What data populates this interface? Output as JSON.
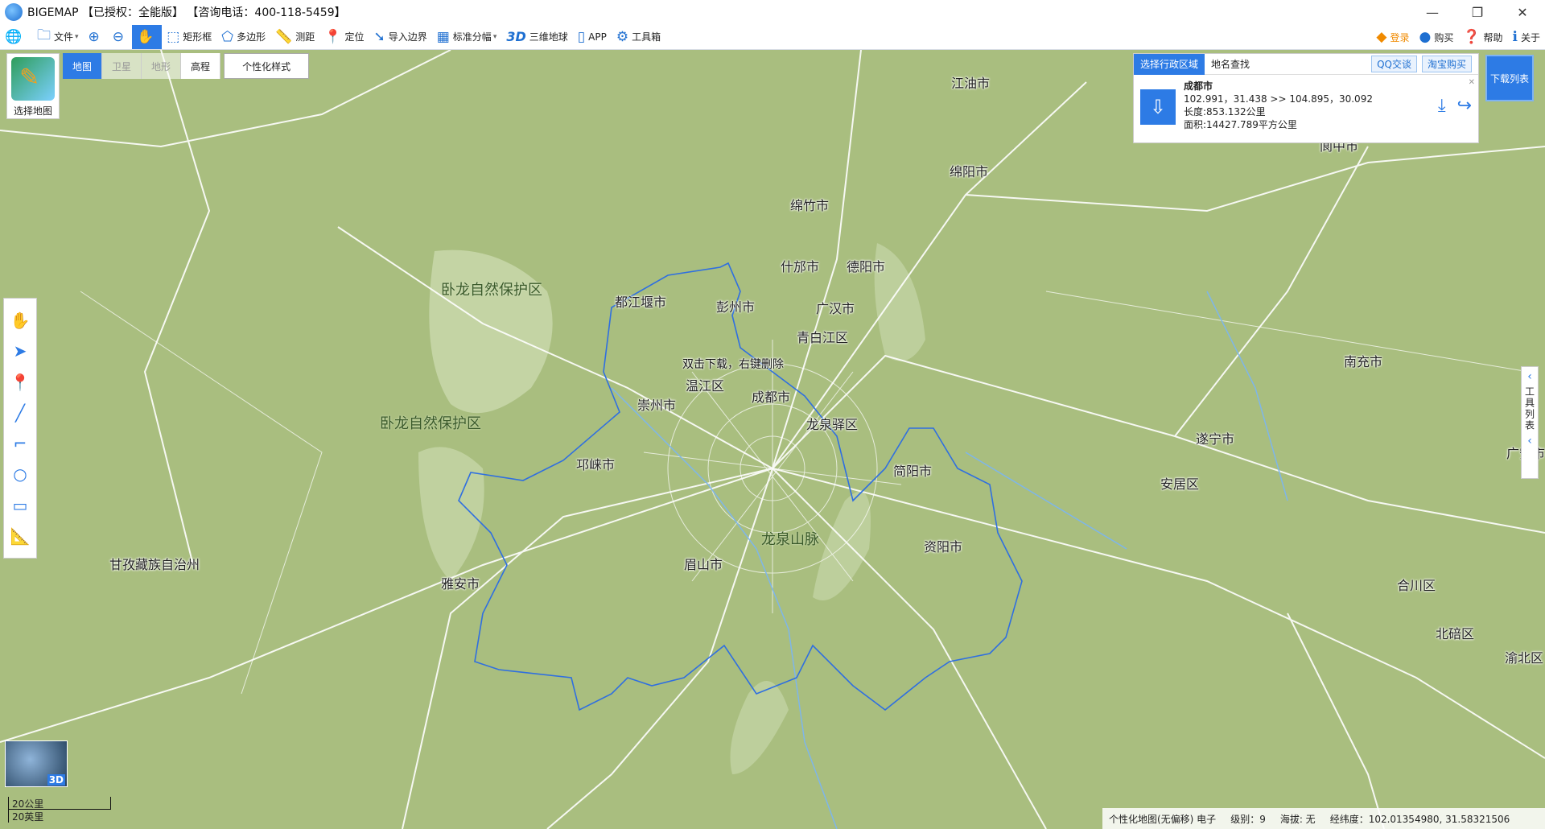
{
  "window": {
    "title": "BIGEMAP 【已授权：全能版】 【咨询电话：400-118-5459】",
    "controls": [
      "—",
      "❐",
      "✕"
    ]
  },
  "toolbar": {
    "items": [
      {
        "label": "文件",
        "icon": "folder-icon",
        "caret": "▾"
      },
      {
        "label": "",
        "icon": "zoom-in-icon"
      },
      {
        "label": "",
        "icon": "zoom-out-icon"
      },
      {
        "label": "",
        "icon": "hand-icon"
      },
      {
        "label": "矩形框",
        "icon": "rectangle-select-icon"
      },
      {
        "label": "多边形",
        "icon": "polygon-icon"
      },
      {
        "label": "测距",
        "icon": "ruler-icon"
      },
      {
        "label": "定位",
        "icon": "location-icon"
      },
      {
        "label": "导入边界",
        "icon": "import-boundary-icon"
      },
      {
        "label": "标准分幅",
        "icon": "grid-icon",
        "caret": "▾"
      },
      {
        "label": "三维地球",
        "icon": "3d-icon",
        "prefix": "3D"
      },
      {
        "label": "APP",
        "icon": "phone-icon"
      },
      {
        "label": "工具箱",
        "icon": "gear-icon"
      }
    ],
    "right": [
      {
        "label": "登录",
        "icon": "user-icon"
      },
      {
        "label": "购买",
        "icon": "buy-icon"
      },
      {
        "label": "帮助",
        "icon": "help-icon"
      },
      {
        "label": "关于",
        "icon": "info-icon"
      }
    ]
  },
  "map_type": {
    "label": "选择地图",
    "tabs": [
      "地图",
      "卫星",
      "地形",
      "高程"
    ],
    "active_tab": "地图",
    "custom_style": "个性化样式"
  },
  "right_panel": {
    "tabs": [
      "选择行政区域",
      "地名查找"
    ],
    "qq": "QQ交谈",
    "taobao": "淘宝购买",
    "region": {
      "name": "成都市",
      "coords": "102.991，31.438 >> 104.895，30.092",
      "length": "长度:853.132公里",
      "area": "面积:14427.789平方公里"
    },
    "download_list": "下载列表",
    "tool_list": "工具列表"
  },
  "map_labels": [
    {
      "text": "江油市",
      "type": "city"
    },
    {
      "text": "绵阳市",
      "type": "city"
    },
    {
      "text": "阆中市",
      "type": "city"
    },
    {
      "text": "绵竹市",
      "type": "city"
    },
    {
      "text": "什邡市",
      "type": "city"
    },
    {
      "text": "德阳市",
      "type": "city"
    },
    {
      "text": "卧龙自然保护区",
      "type": "area"
    },
    {
      "text": "都江堰市",
      "type": "city"
    },
    {
      "text": "彭州市",
      "type": "city"
    },
    {
      "text": "广汉市",
      "type": "city"
    },
    {
      "text": "青白江区",
      "type": "city"
    },
    {
      "text": "双击下载，右键删除",
      "type": "hint"
    },
    {
      "text": "温江区",
      "type": "city"
    },
    {
      "text": "成都市",
      "type": "city"
    },
    {
      "text": "崇州市",
      "type": "city"
    },
    {
      "text": "龙泉驿区",
      "type": "city"
    },
    {
      "text": "南充市",
      "type": "city"
    },
    {
      "text": "卧龙自然保护区",
      "type": "area"
    },
    {
      "text": "遂宁市",
      "type": "city"
    },
    {
      "text": "邛崃市",
      "type": "city"
    },
    {
      "text": "简阳市",
      "type": "city"
    },
    {
      "text": "广安市",
      "type": "city"
    },
    {
      "text": "安居区",
      "type": "city"
    },
    {
      "text": "龙泉山脉",
      "type": "area"
    },
    {
      "text": "资阳市",
      "type": "city"
    },
    {
      "text": "甘孜藏族自治州",
      "type": "city"
    },
    {
      "text": "眉山市",
      "type": "city"
    },
    {
      "text": "雅安市",
      "type": "city"
    },
    {
      "text": "合川区",
      "type": "city"
    },
    {
      "text": "北碚区",
      "type": "city"
    },
    {
      "text": "渝北区",
      "type": "city"
    }
  ],
  "minimap_label": "3D",
  "scale": {
    "km": "20公里",
    "mi": "20英里"
  },
  "status": {
    "map_name": "个性化地图(无偏移) 电子",
    "level": "级别：9",
    "altitude": "海拔: 无",
    "lnglat": "经纬度：102.01354980, 31.58321506"
  },
  "colors": {
    "accent": "#2d7be5",
    "map_bg": "#a9be7f",
    "boundary": "#2f6fe0",
    "road": "#ffffff"
  }
}
